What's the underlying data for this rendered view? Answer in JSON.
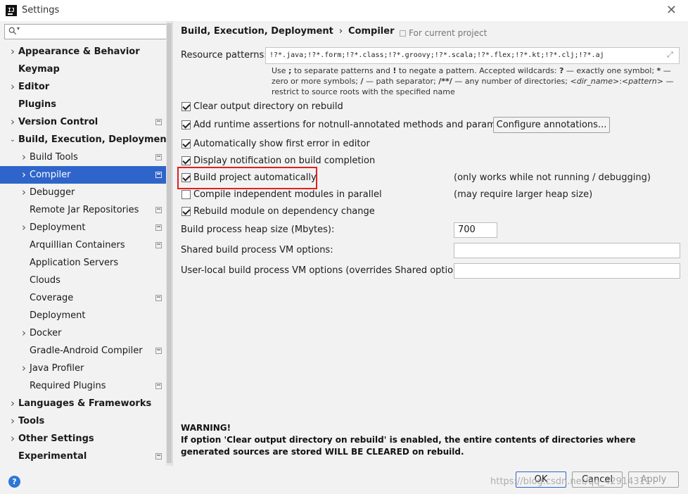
{
  "window": {
    "title": "Settings",
    "logo_text": "IJ"
  },
  "sidebar": {
    "search_placeholder": "",
    "items": [
      {
        "label": "Appearance & Behavior",
        "bold": true,
        "level": 0,
        "chevron": "right",
        "project_icon": false
      },
      {
        "label": "Keymap",
        "bold": true,
        "level": 0,
        "chevron": "",
        "project_icon": false
      },
      {
        "label": "Editor",
        "bold": true,
        "level": 0,
        "chevron": "right",
        "project_icon": false
      },
      {
        "label": "Plugins",
        "bold": true,
        "level": 0,
        "chevron": "",
        "project_icon": false
      },
      {
        "label": "Version Control",
        "bold": true,
        "level": 0,
        "chevron": "right",
        "project_icon": true
      },
      {
        "label": "Build, Execution, Deployment",
        "bold": true,
        "level": 0,
        "chevron": "down",
        "project_icon": false
      },
      {
        "label": "Build Tools",
        "bold": false,
        "level": 1,
        "chevron": "right",
        "project_icon": true
      },
      {
        "label": "Compiler",
        "bold": false,
        "level": 1,
        "chevron": "right",
        "project_icon": true,
        "selected": true
      },
      {
        "label": "Debugger",
        "bold": false,
        "level": 1,
        "chevron": "right",
        "project_icon": false
      },
      {
        "label": "Remote Jar Repositories",
        "bold": false,
        "level": 1,
        "chevron": "",
        "project_icon": true
      },
      {
        "label": "Deployment",
        "bold": false,
        "level": 1,
        "chevron": "right",
        "project_icon": true
      },
      {
        "label": "Arquillian Containers",
        "bold": false,
        "level": 1,
        "chevron": "",
        "project_icon": true
      },
      {
        "label": "Application Servers",
        "bold": false,
        "level": 1,
        "chevron": "",
        "project_icon": false
      },
      {
        "label": "Clouds",
        "bold": false,
        "level": 1,
        "chevron": "",
        "project_icon": false
      },
      {
        "label": "Coverage",
        "bold": false,
        "level": 1,
        "chevron": "",
        "project_icon": true
      },
      {
        "label": "Deployment",
        "bold": false,
        "level": 1,
        "chevron": "",
        "project_icon": false
      },
      {
        "label": "Docker",
        "bold": false,
        "level": 1,
        "chevron": "right",
        "project_icon": false
      },
      {
        "label": "Gradle-Android Compiler",
        "bold": false,
        "level": 1,
        "chevron": "",
        "project_icon": true
      },
      {
        "label": "Java Profiler",
        "bold": false,
        "level": 1,
        "chevron": "right",
        "project_icon": false
      },
      {
        "label": "Required Plugins",
        "bold": false,
        "level": 1,
        "chevron": "",
        "project_icon": true
      },
      {
        "label": "Languages & Frameworks",
        "bold": true,
        "level": 0,
        "chevron": "right",
        "project_icon": false
      },
      {
        "label": "Tools",
        "bold": true,
        "level": 0,
        "chevron": "right",
        "project_icon": false
      },
      {
        "label": "Other Settings",
        "bold": true,
        "level": 0,
        "chevron": "right",
        "project_icon": false
      },
      {
        "label": "Experimental",
        "bold": true,
        "level": 0,
        "chevron": "",
        "project_icon": true
      }
    ]
  },
  "main": {
    "breadcrumb": [
      "Build, Execution, Deployment",
      "Compiler"
    ],
    "breadcrumb_separator": "›",
    "scope_note": "For current project",
    "resource_patterns_label": "Resource patterns:",
    "resource_patterns_value": "!?*.java;!?*.form;!?*.class;!?*.groovy;!?*.scala;!?*.flex;!?*.kt;!?*.clj;!?*.aj",
    "hint": {
      "p1": "Use ",
      "b1": ";",
      "p2": " to separate patterns and ",
      "b2": "!",
      "p3": " to negate a pattern. Accepted wildcards: ",
      "b3": "?",
      "p4": " — exactly one symbol; ",
      "b4": "*",
      "p5": " — zero or more symbols; ",
      "b5": "/",
      "p6": " — path separator; ",
      "b6": "/**/",
      "p7": " — any number of directories; ",
      "i1": "<dir_name>",
      "p8": ":",
      "i2": "<pattern>",
      "p9": " — restrict to source roots with the specified name"
    },
    "checkboxes": {
      "clear_output": {
        "label": "Clear output directory on rebuild",
        "checked": true
      },
      "runtime_assertions": {
        "label": "Add runtime assertions for notnull-annotated methods and parameters",
        "checked": true
      },
      "show_first_error": {
        "label": "Automatically show first error in editor",
        "checked": true
      },
      "display_notification": {
        "label": "Display notification on build completion",
        "checked": true
      },
      "build_automatically": {
        "label": "Build project automatically",
        "checked": true
      },
      "compile_parallel": {
        "label": "Compile independent modules in parallel",
        "checked": false
      },
      "rebuild_on_change": {
        "label": "Rebuild module on dependency change",
        "checked": true
      }
    },
    "configure_annotations_label": "Configure annotations...",
    "notes": {
      "build_automatically": "(only works while not running / debugging)",
      "compile_parallel": "(may require larger heap size)"
    },
    "heap_size_label": "Build process heap size (Mbytes):",
    "heap_size_value": "700",
    "shared_vm_label": "Shared build process VM options:",
    "shared_vm_value": "",
    "user_vm_label": "User-local build process VM options (overrides Shared options):",
    "user_vm_value": "",
    "warning_title": "WARNING!",
    "warning_text": "If option 'Clear output directory on rebuild' is enabled, the entire contents of directories where generated sources are stored WILL BE CLEARED on rebuild."
  },
  "footer": {
    "help_label": "?",
    "ok_label": "OK",
    "cancel_label": "Cancel",
    "apply_label": "Apply",
    "watermark": "https://blog.csdn.net/qq_42914311"
  },
  "colors": {
    "selection": "#2f65ca",
    "highlight_box": "#e02020",
    "help_icon": "#2e76d6"
  }
}
